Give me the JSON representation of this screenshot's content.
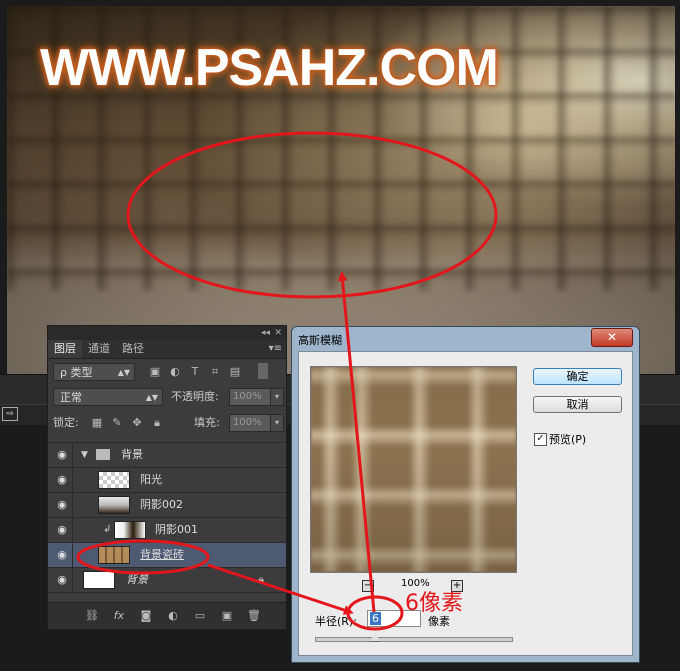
{
  "canvas": {
    "watermark": "WWW.PSAHZ.COM"
  },
  "layers_panel": {
    "header": {
      "collapse": "◂◂",
      "close": "✕"
    },
    "tabs": [
      {
        "label": "图层"
      },
      {
        "label": "通道"
      },
      {
        "label": "路径"
      }
    ],
    "menu": "▾≡",
    "filter": {
      "label": "ρ 类型"
    },
    "blend_mode": {
      "value": "正常"
    },
    "opacity": {
      "label": "不透明度:",
      "value": "100%"
    },
    "lock": {
      "label": "锁定:"
    },
    "fill": {
      "label": "填充:",
      "value": "100%"
    },
    "layers": [
      {
        "name": "背景",
        "type": "group",
        "expanded": true
      },
      {
        "name": "阳光"
      },
      {
        "name": "阴影002"
      },
      {
        "name": "阴影001",
        "clipped": true
      },
      {
        "name": "背景瓷砖",
        "selected": true
      },
      {
        "name": "背景",
        "locked": true,
        "italic": true
      }
    ]
  },
  "dialog": {
    "title": "高斯模糊",
    "close": "✕",
    "ok_label": "确定",
    "cancel_label": "取消",
    "preview_label": "预览(P)",
    "preview_checked": true,
    "zoom_minus": "−",
    "zoom_plus": "+",
    "zoom": "100%",
    "radius_label": "半径(R):",
    "radius_value": "6",
    "radius_unit": "像素",
    "radius_fraction": 0.3
  },
  "annotation": {
    "text": "6像素",
    "color": "#e3161b"
  }
}
